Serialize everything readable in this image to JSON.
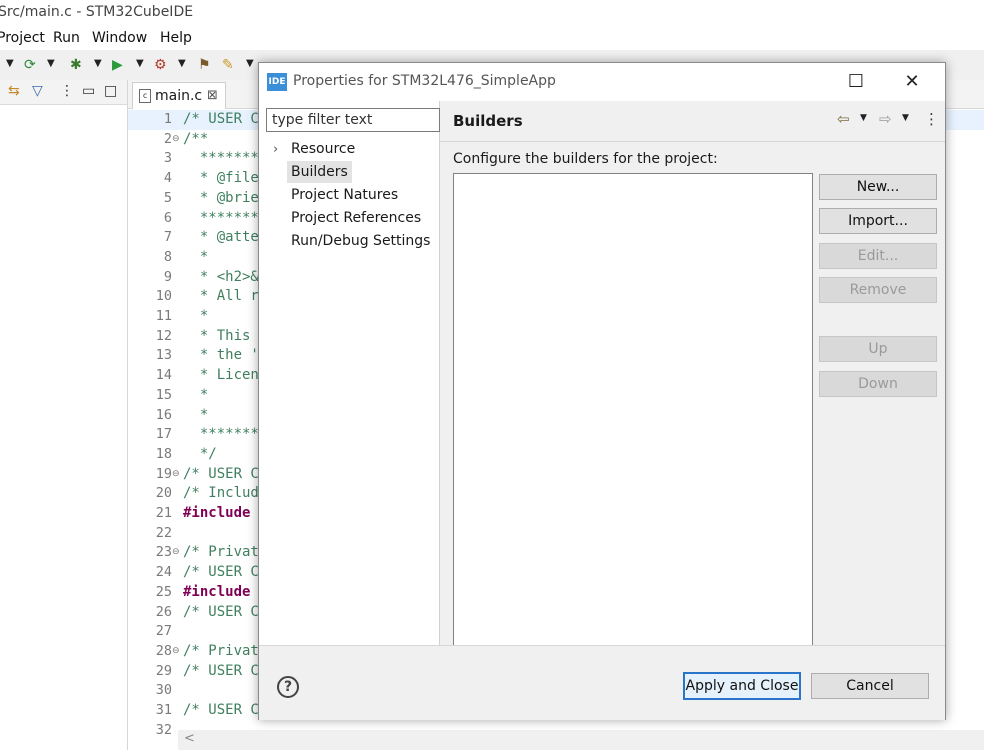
{
  "window": {
    "title": "Src/main.c - STM32CubeIDE"
  },
  "menu": [
    "Project",
    "Run",
    "Window",
    "Help"
  ],
  "editor": {
    "tab_label": "main.c",
    "lines": [
      {
        "n": "1",
        "fold": "",
        "text": "/* USER C",
        "kind": "comment"
      },
      {
        "n": "2",
        "fold": "⊖",
        "text": "/**",
        "kind": "comment"
      },
      {
        "n": "3",
        "fold": "",
        "text": "  *******",
        "kind": "comment"
      },
      {
        "n": "4",
        "fold": "",
        "text": "  * @file",
        "kind": "comment"
      },
      {
        "n": "5",
        "fold": "",
        "text": "  * @brie",
        "kind": "comment"
      },
      {
        "n": "6",
        "fold": "",
        "text": "  *******",
        "kind": "comment"
      },
      {
        "n": "7",
        "fold": "",
        "text": "  * @atte",
        "kind": "comment"
      },
      {
        "n": "8",
        "fold": "",
        "text": "  *",
        "kind": "comment"
      },
      {
        "n": "9",
        "fold": "",
        "text": "  * <h2>&",
        "kind": "comment"
      },
      {
        "n": "10",
        "fold": "",
        "text": "  * All r",
        "kind": "comment"
      },
      {
        "n": "11",
        "fold": "",
        "text": "  *",
        "kind": "comment"
      },
      {
        "n": "12",
        "fold": "",
        "text": "  * This",
        "kind": "comment"
      },
      {
        "n": "13",
        "fold": "",
        "text": "  * the '",
        "kind": "comment"
      },
      {
        "n": "14",
        "fold": "",
        "text": "  * Licen",
        "kind": "comment"
      },
      {
        "n": "15",
        "fold": "",
        "text": "  *",
        "kind": "comment"
      },
      {
        "n": "16",
        "fold": "",
        "text": "  *",
        "kind": "comment"
      },
      {
        "n": "17",
        "fold": "",
        "text": "  *******",
        "kind": "comment"
      },
      {
        "n": "18",
        "fold": "",
        "text": "  */",
        "kind": "comment"
      },
      {
        "n": "19",
        "fold": "⊖",
        "text": "/* USER C",
        "kind": "comment"
      },
      {
        "n": "20",
        "fold": "",
        "text": "/* Includ",
        "kind": "comment"
      },
      {
        "n": "21",
        "fold": "",
        "text": "#include ",
        "kind": "keyword"
      },
      {
        "n": "22",
        "fold": "",
        "text": "",
        "kind": "comment"
      },
      {
        "n": "23",
        "fold": "⊖",
        "text": "/* Privat",
        "kind": "comment"
      },
      {
        "n": "24",
        "fold": "",
        "text": "/* USER C",
        "kind": "comment"
      },
      {
        "n": "25",
        "fold": "",
        "text": "#include ",
        "kind": "keyword"
      },
      {
        "n": "26",
        "fold": "",
        "text": "/* USER C",
        "kind": "comment"
      },
      {
        "n": "27",
        "fold": "",
        "text": "",
        "kind": "comment"
      },
      {
        "n": "28",
        "fold": "⊖",
        "text": "/* Privat",
        "kind": "comment"
      },
      {
        "n": "29",
        "fold": "",
        "text": "/* USER C",
        "kind": "comment"
      },
      {
        "n": "30",
        "fold": "",
        "text": "",
        "kind": "comment"
      },
      {
        "n": "31",
        "fold": "",
        "text": "/* USER C",
        "kind": "comment"
      },
      {
        "n": "32",
        "fold": "",
        "text": "",
        "kind": "comment"
      }
    ]
  },
  "dialog": {
    "title": "Properties for STM32L476_SimpleApp",
    "logo_text": "IDE",
    "filter_placeholder": "type filter text",
    "nav": [
      "Resource",
      "Builders",
      "Project Natures",
      "Project References",
      "Run/Debug Settings"
    ],
    "selected_nav": "Builders",
    "page_title": "Builders",
    "description": "Configure the builders for the project:",
    "buttons": [
      {
        "label": "New...",
        "enabled": true
      },
      {
        "label": "Import...",
        "enabled": true
      },
      {
        "label": "Edit...",
        "enabled": false
      },
      {
        "label": "Remove",
        "enabled": false
      },
      {
        "label": "Up",
        "enabled": false
      },
      {
        "label": "Down",
        "enabled": false
      }
    ],
    "apply_label": "Apply and Close",
    "cancel_label": "Cancel",
    "help_glyph": "?"
  }
}
